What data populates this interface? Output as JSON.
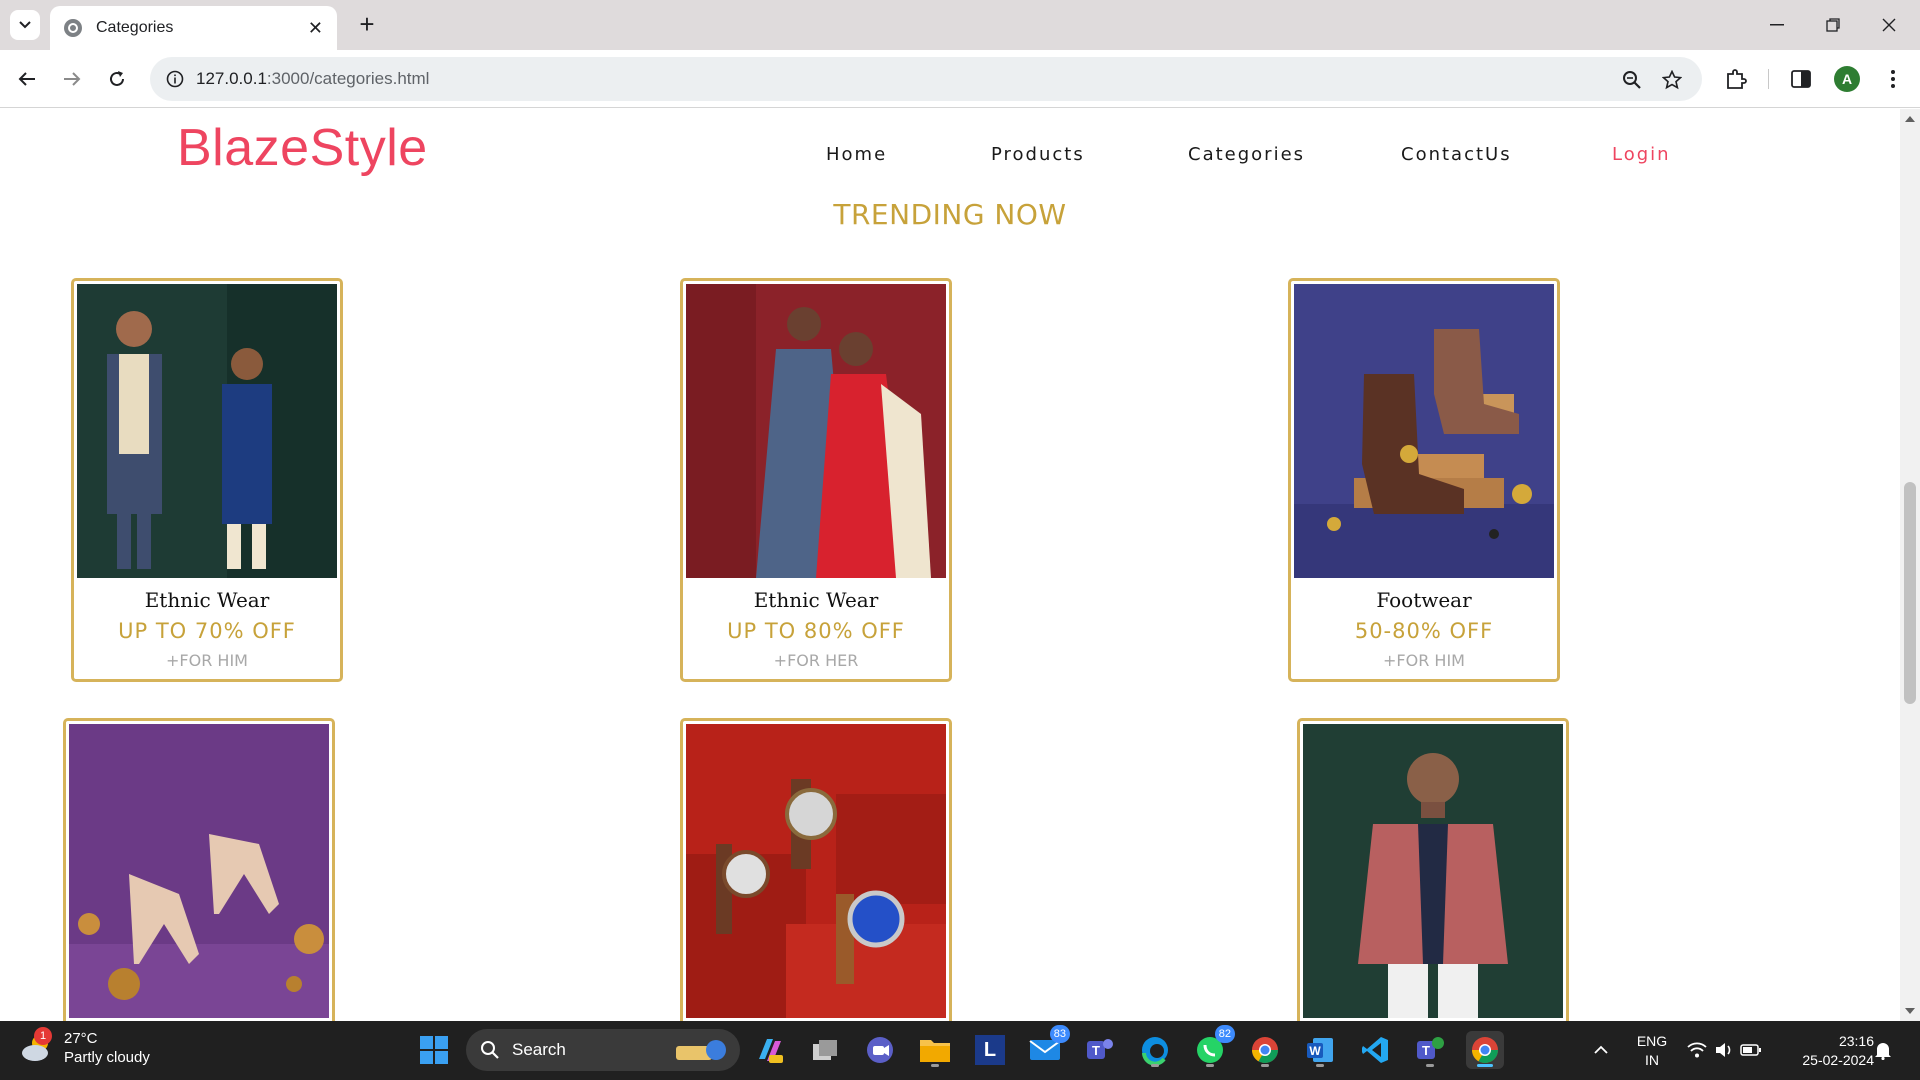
{
  "browser": {
    "tab_title": "Categories",
    "url_host": "127.0.0.1",
    "url_path": ":3000/categories.html",
    "profile_initial": "A"
  },
  "site": {
    "logo": "BlazeStyle",
    "nav": [
      "Home",
      "Products",
      "Categories",
      "ContactUs",
      "Login"
    ],
    "section_title": "TRENDING NOW"
  },
  "cards": [
    {
      "title": "Ethnic Wear",
      "offer": "UP TO 70% OFF",
      "sub": "+FOR HIM"
    },
    {
      "title": "Ethnic Wear",
      "offer": "UP TO 80% OFF",
      "sub": "+FOR HER"
    },
    {
      "title": "Footwear",
      "offer": "50-80% OFF",
      "sub": "+FOR HIM"
    },
    {
      "title": "",
      "offer": "",
      "sub": ""
    },
    {
      "title": "",
      "offer": "",
      "sub": ""
    },
    {
      "title": "",
      "offer": "",
      "sub": ""
    }
  ],
  "taskbar": {
    "weather_temp": "27°C",
    "weather_desc": "Partly cloudy",
    "weather_badge": "1",
    "search_label": "Search",
    "mail_badge": "83",
    "whatsapp_badge": "82",
    "lang_line1": "ENG",
    "lang_line2": "IN",
    "time": "23:16",
    "date": "25-02-2024"
  },
  "colors": {
    "brand": "#ee4560",
    "gold": "#c7a23a"
  }
}
